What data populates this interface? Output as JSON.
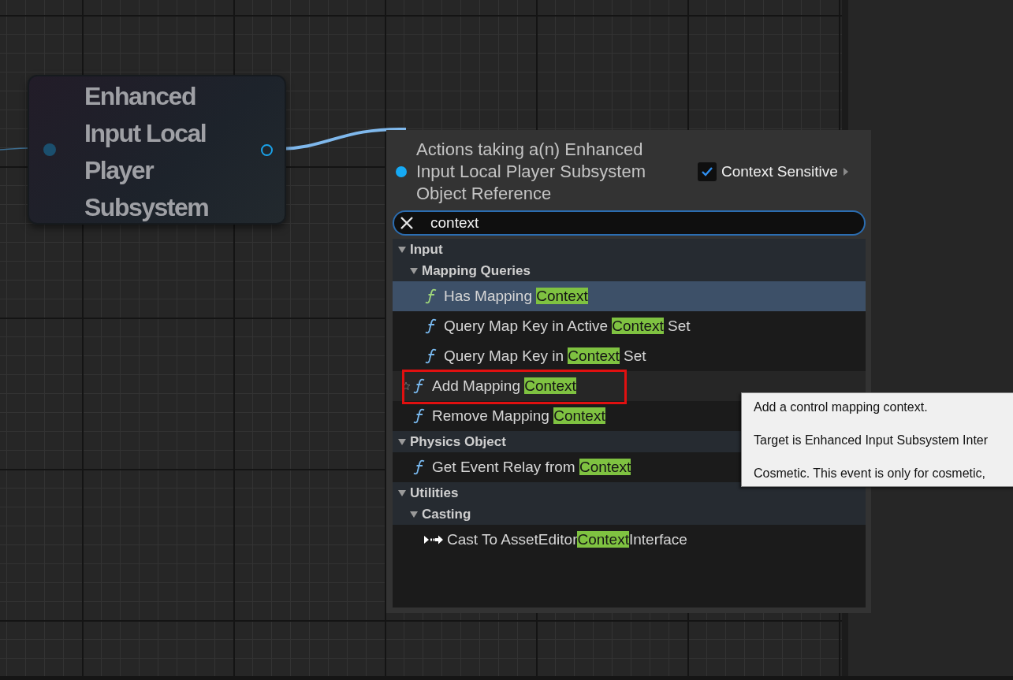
{
  "graph": {
    "node": {
      "title": "Enhanced Input Local Player Subsystem"
    }
  },
  "action_menu": {
    "title": "Actions taking a(n) Enhanced Input Local Player Subsystem Object Reference",
    "context_sensitive": {
      "label": "Context Sensitive",
      "checked": true
    },
    "search": {
      "value": "context"
    },
    "tree": [
      {
        "kind": "category",
        "label": "Input",
        "expanded": true,
        "children": [
          {
            "kind": "category",
            "label": "Mapping Queries",
            "expanded": true,
            "children": [
              {
                "kind": "function",
                "before": "Has Mapping ",
                "match": "Context",
                "selected": true,
                "hovered": false,
                "annotated": false
              },
              {
                "kind": "function",
                "before": "Query Map Key in Active ",
                "match": "Context",
                "after": " Set",
                "selected": false,
                "hovered": false,
                "annotated": false
              },
              {
                "kind": "function",
                "before": "Query Map Key in ",
                "match": "Context",
                "after": " Set",
                "selected": false,
                "hovered": false,
                "annotated": false
              }
            ]
          },
          {
            "kind": "function",
            "before": "Add Mapping ",
            "match": "Context",
            "selected": false,
            "hovered": true,
            "annotated": true
          },
          {
            "kind": "function",
            "before": "Remove Mapping ",
            "match": "Context",
            "selected": false,
            "hovered": false,
            "annotated": false
          }
        ]
      },
      {
        "kind": "category",
        "label": "Physics Object",
        "expanded": true,
        "children": [
          {
            "kind": "function",
            "before": "Get Event Relay from ",
            "match": "Context",
            "selected": false,
            "hovered": false,
            "annotated": false
          }
        ]
      },
      {
        "kind": "category",
        "label": "Utilities",
        "expanded": true,
        "children": [
          {
            "kind": "category",
            "label": "Casting",
            "expanded": true,
            "children": [
              {
                "kind": "cast",
                "before": "Cast To AssetEditor",
                "match": "Context",
                "after": "Interface",
                "selected": false,
                "hovered": false,
                "annotated": false
              }
            ]
          }
        ]
      }
    ]
  },
  "tooltip": {
    "lines": [
      "Add a control mapping context.",
      "Target is Enhanced Input Subsystem Inter",
      "Cosmetic. This event is only for cosmetic,"
    ]
  }
}
